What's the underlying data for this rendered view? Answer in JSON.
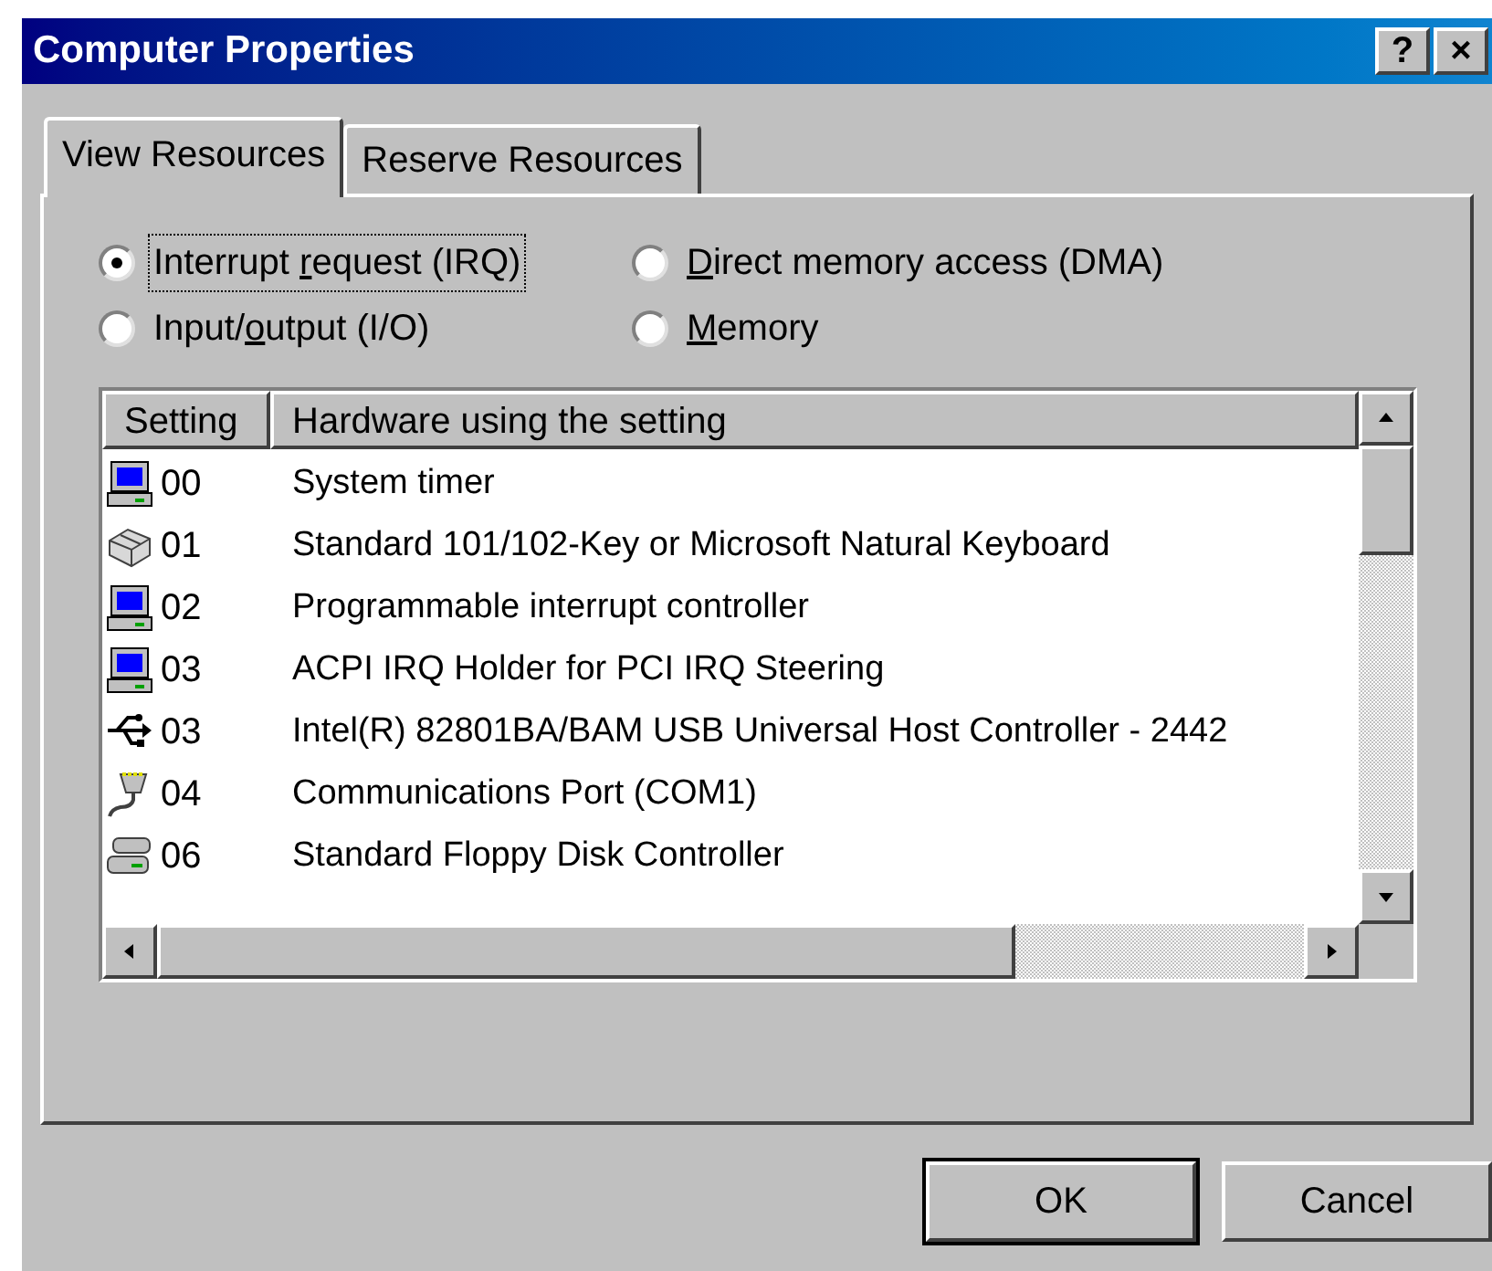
{
  "window": {
    "title": "Computer Properties",
    "controls": [
      "?",
      "×"
    ]
  },
  "tabs": [
    {
      "label": "View Resources",
      "selected": true
    },
    {
      "label": "Reserve Resources",
      "selected": false
    }
  ],
  "radios": [
    {
      "pre": "Interrupt ",
      "key": "r",
      "post": "equest (IRQ)",
      "selected": true
    },
    {
      "key": "D",
      "post": "irect memory access (DMA)",
      "selected": false
    },
    {
      "pre": "Input/",
      "key": "o",
      "post": "utput (I/O)",
      "selected": false
    },
    {
      "key": "M",
      "post": "emory",
      "selected": false
    }
  ],
  "table": {
    "columns": [
      "Setting",
      "Hardware using the setting"
    ],
    "rows": [
      {
        "kind": "computer",
        "setting": "00",
        "hardware": "System timer"
      },
      {
        "kind": "keyboard",
        "setting": "01",
        "hardware": "Standard 101/102-Key or Microsoft Natural Keyboard"
      },
      {
        "kind": "computer",
        "setting": "02",
        "hardware": "Programmable interrupt controller"
      },
      {
        "kind": "computer",
        "setting": "03",
        "hardware": "ACPI IRQ Holder for PCI IRQ Steering"
      },
      {
        "kind": "usb",
        "setting": "03",
        "hardware": "Intel(R) 82801BA/BAM USB Universal Host Controller - 2442"
      },
      {
        "kind": "port",
        "setting": "04",
        "hardware": "Communications Port (COM1)"
      },
      {
        "kind": "floppy",
        "setting": "06",
        "hardware": "Standard Floppy Disk Controller"
      }
    ]
  },
  "buttons": [
    {
      "label": "OK",
      "default": true
    },
    {
      "label": "Cancel",
      "default": false
    }
  ]
}
